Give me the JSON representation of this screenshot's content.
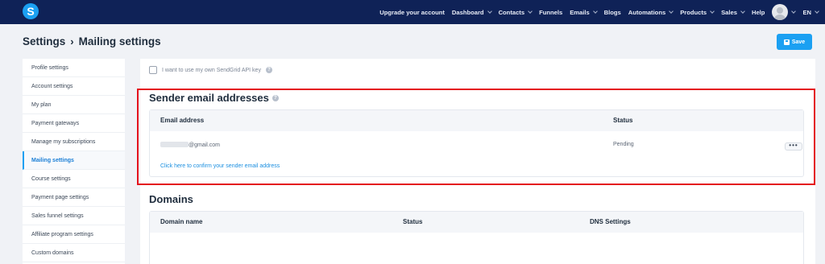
{
  "topnav": {
    "logo": "S",
    "items": [
      {
        "label": "Upgrade your account",
        "dropdown": false
      },
      {
        "label": "Dashboard",
        "dropdown": true
      },
      {
        "label": "Contacts",
        "dropdown": true
      },
      {
        "label": "Funnels",
        "dropdown": false
      },
      {
        "label": "Emails",
        "dropdown": true
      },
      {
        "label": "Blogs",
        "dropdown": false
      },
      {
        "label": "Automations",
        "dropdown": true
      },
      {
        "label": "Products",
        "dropdown": true
      },
      {
        "label": "Sales",
        "dropdown": true
      },
      {
        "label": "Help",
        "dropdown": false
      }
    ],
    "language": "EN"
  },
  "header": {
    "crumb_root": "Settings",
    "crumb_sep": "›",
    "crumb_current": "Mailing settings",
    "save_label": "Save"
  },
  "sidebar": {
    "items": [
      {
        "label": "Profile settings",
        "active": false
      },
      {
        "label": "Account settings",
        "active": false
      },
      {
        "label": "My plan",
        "active": false
      },
      {
        "label": "Payment gateways",
        "active": false
      },
      {
        "label": "Manage my subscriptions",
        "active": false
      },
      {
        "label": "Mailing settings",
        "active": true
      },
      {
        "label": "Course settings",
        "active": false
      },
      {
        "label": "Payment page settings",
        "active": false
      },
      {
        "label": "Sales funnel settings",
        "active": false
      },
      {
        "label": "Affiliate program settings",
        "active": false
      },
      {
        "label": "Custom domains",
        "active": false
      }
    ]
  },
  "main": {
    "api_key_label": "I want to use my own SendGrid API key",
    "sender": {
      "title": "Sender email addresses",
      "col_email": "Email address",
      "col_status": "Status",
      "row_email": "@gmail.com",
      "row_status": "Pending",
      "more": "•••",
      "confirm_link": "Click here to confirm your sender email address"
    },
    "domains": {
      "title": "Domains",
      "col_domain": "Domain name",
      "col_status": "Status",
      "col_dns": "DNS Settings"
    }
  },
  "colors": {
    "nav_bg": "#0f2257",
    "accent": "#1ba0f2",
    "highlight": "#e4121d"
  }
}
